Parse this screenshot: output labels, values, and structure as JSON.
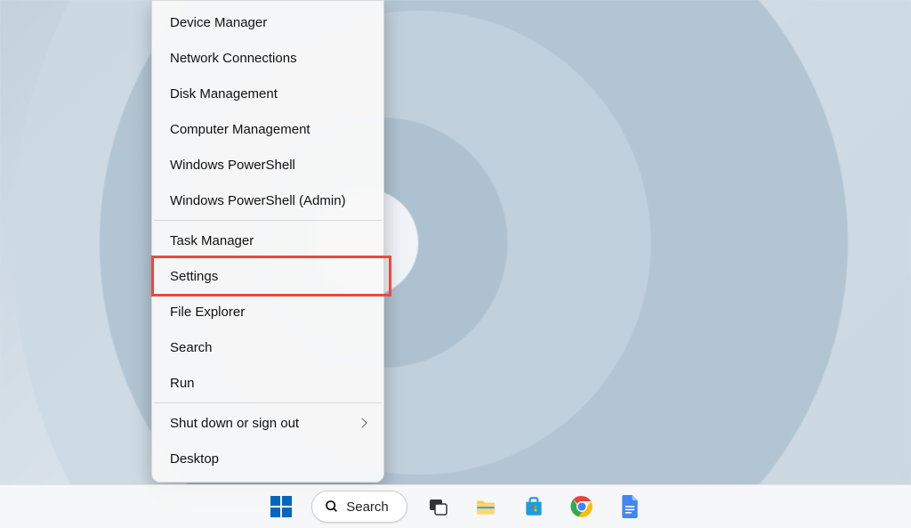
{
  "context_menu": {
    "groups": [
      [
        "Device Manager",
        "Network Connections",
        "Disk Management",
        "Computer Management",
        "Windows PowerShell",
        "Windows PowerShell (Admin)"
      ],
      [
        "Task Manager",
        "Settings",
        "File Explorer",
        "Search",
        "Run"
      ],
      [
        "Shut down or sign out",
        "Desktop"
      ]
    ],
    "submenu_items": [
      "Shut down or sign out"
    ],
    "highlighted_item": "Settings"
  },
  "taskbar": {
    "search_label": "Search"
  }
}
